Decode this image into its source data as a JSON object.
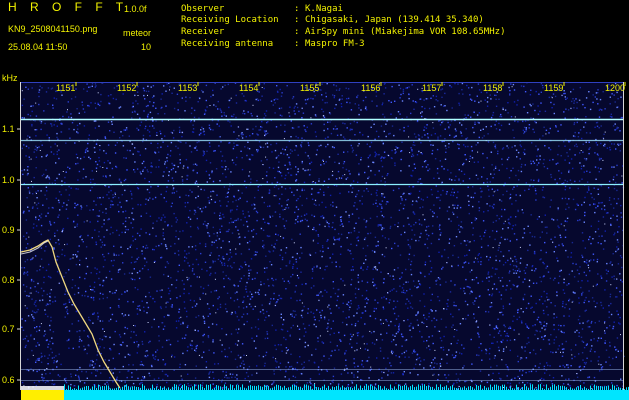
{
  "header": {
    "app_title": "H R O F F T",
    "version": "1.0.0f",
    "file_name": "KN9_2508041150.png",
    "meteor_label": "meteor",
    "datetime": "25.08.04 11:50",
    "meteor_count": "10",
    "info": [
      {
        "key": "Observer",
        "value": "K.Nagai"
      },
      {
        "key": "Receiving Location",
        "value": "Chigasaki, Japan (139.414 35.340)"
      },
      {
        "key": "Receiver",
        "value": "AirSpy mini (Miakejima VOR 108.65MHz)"
      },
      {
        "key": "Receiving antenna",
        "value": "Maspro FM-3"
      }
    ]
  },
  "axis": {
    "y_unit_label": "kHz",
    "y_ticks": [
      "1.1",
      "1.0",
      "0.9",
      "0.8",
      "0.7",
      "0.6"
    ],
    "x_ticks": [
      "1151",
      "1152",
      "1153",
      "1154",
      "1155",
      "1156",
      "1157",
      "1158",
      "1159",
      "1200"
    ]
  },
  "colors": {
    "header_text": "#f2f200",
    "background": "#000000",
    "noise": "#1a2aa0",
    "carrier_line": "#8cf0ff",
    "baseline": "#00e5ff",
    "marker": "#ffee00"
  }
}
